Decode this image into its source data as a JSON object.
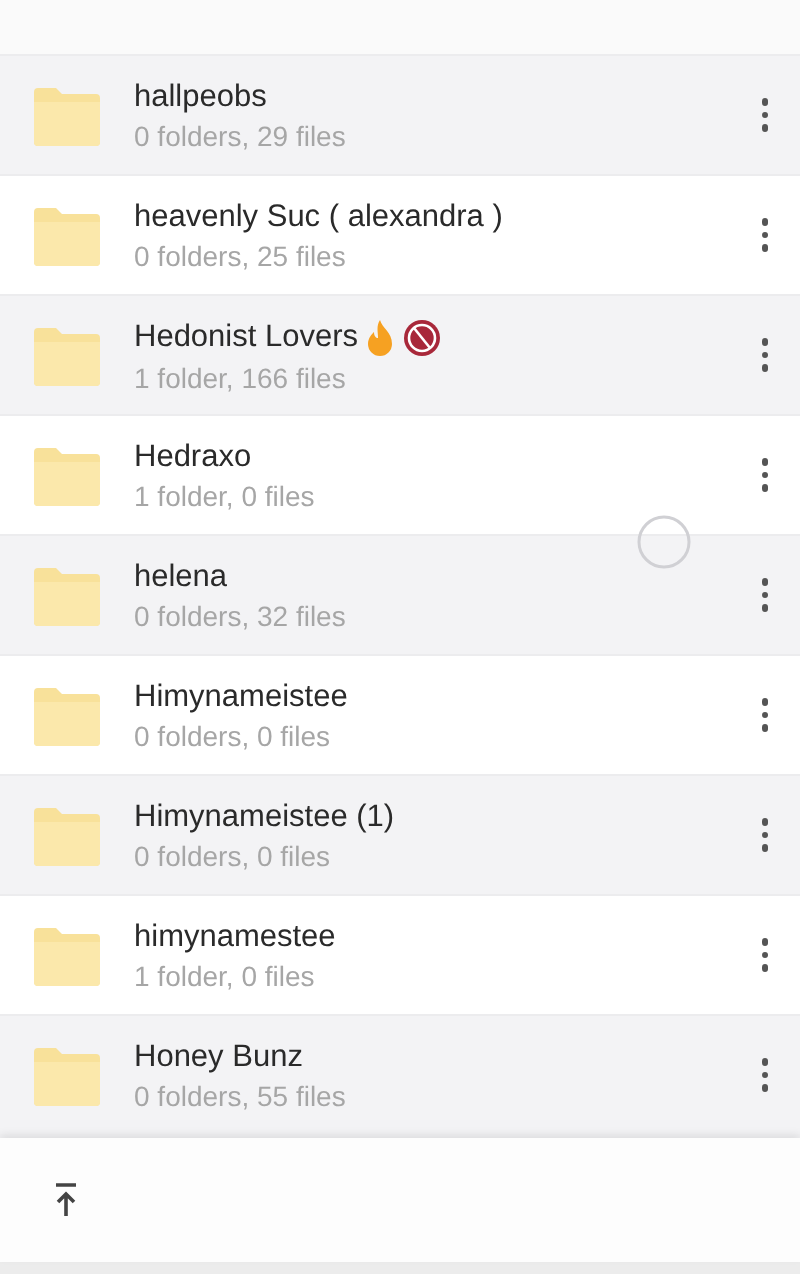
{
  "folders": [
    {
      "name": "hallpeobs",
      "details": "0 folders, 29 files",
      "kind": "plain"
    },
    {
      "name": "heavenly Suc ( alexandra )",
      "details": "0 folders, 25 files",
      "kind": "plain"
    },
    {
      "name": "Hedonist Lovers",
      "details": "1 folder, 166 files",
      "kind": "marked"
    },
    {
      "name": "Hedraxo",
      "details": "1 folder, 0 files",
      "kind": "plain"
    },
    {
      "name": "helena",
      "details": "0 folders, 32 files",
      "kind": "plain"
    },
    {
      "name": "Himynameistee",
      "details": "0 folders, 0 files",
      "kind": "plain"
    },
    {
      "name": "Himynameistee (1)",
      "details": "0 folders, 0 files",
      "kind": "plain"
    },
    {
      "name": "himynamestee",
      "details": "1 folder, 0 files",
      "kind": "plain"
    },
    {
      "name": "Honey Bunz",
      "details": "0 folders, 55 files",
      "kind": "plain"
    }
  ]
}
